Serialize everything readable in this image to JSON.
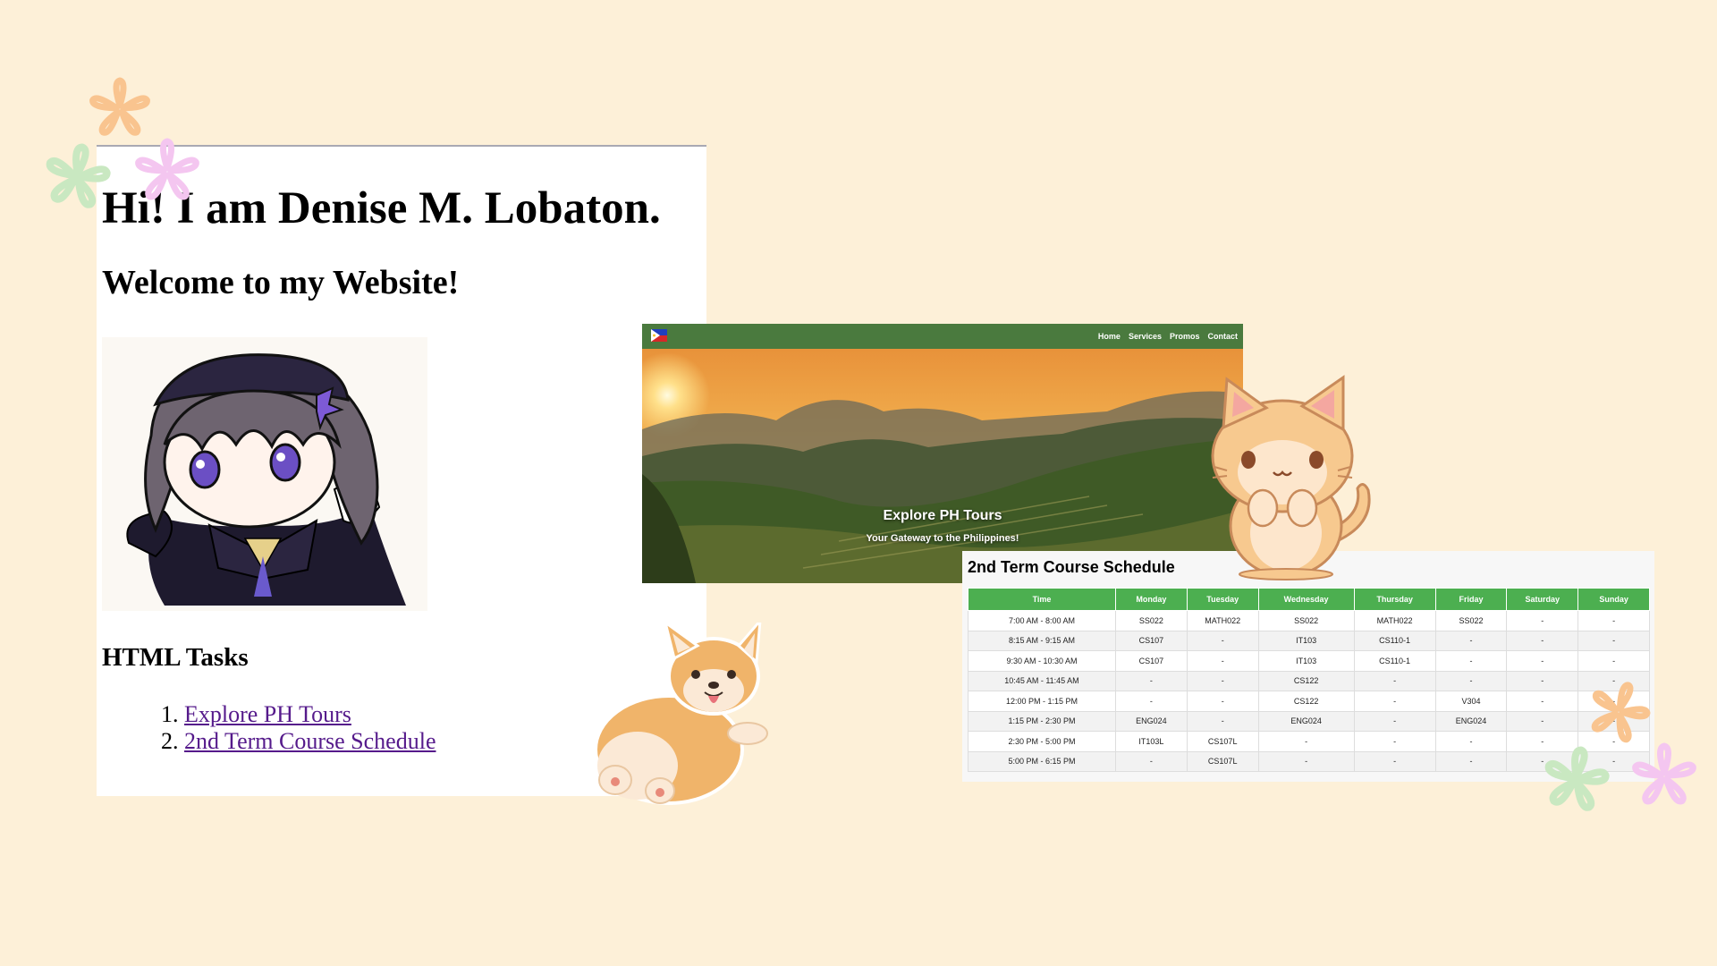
{
  "colors": {
    "background": "#fdf0d8",
    "link": "#551a8b",
    "nav_green": "#4a7a3e",
    "table_header": "#4caf50",
    "flower_orange": "#f9c48f",
    "flower_green": "#c9e8c1",
    "flower_pink": "#f4c6f0"
  },
  "home": {
    "heading": "Hi! I am Denise M. Lobaton.",
    "welcome": "Welcome to my Website!",
    "tasks_heading": "HTML Tasks",
    "tasks": [
      {
        "number": "1.",
        "label": "Explore PH Tours"
      },
      {
        "number": "2.",
        "label": "2nd Term Course Schedule"
      }
    ]
  },
  "tours": {
    "nav": [
      "Home",
      "Services",
      "Promos",
      "Contact"
    ],
    "hero_title": "Explore PH Tours",
    "hero_subtitle": "Your Gateway to the Philippines!"
  },
  "schedule": {
    "title": "2nd Term Course Schedule",
    "columns": [
      "Time",
      "Monday",
      "Tuesday",
      "Wednesday",
      "Thursday",
      "Friday",
      "Saturday",
      "Sunday"
    ],
    "rows": [
      [
        "7:00 AM - 8:00 AM",
        "SS022",
        "MATH022",
        "SS022",
        "MATH022",
        "SS022",
        "-",
        "-"
      ],
      [
        "8:15 AM - 9:15 AM",
        "CS107",
        "-",
        "IT103",
        "CS110-1",
        "-",
        "-",
        "-"
      ],
      [
        "9:30 AM - 10:30 AM",
        "CS107",
        "-",
        "IT103",
        "CS110-1",
        "-",
        "-",
        "-"
      ],
      [
        "10:45 AM - 11:45 AM",
        "-",
        "-",
        "CS122",
        "-",
        "-",
        "-",
        "-"
      ],
      [
        "12:00 PM - 1:15 PM",
        "-",
        "-",
        "CS122",
        "-",
        "V304",
        "-",
        "-"
      ],
      [
        "1:15 PM - 2:30 PM",
        "ENG024",
        "-",
        "ENG024",
        "-",
        "ENG024",
        "-",
        "-"
      ],
      [
        "2:30 PM - 5:00 PM",
        "IT103L",
        "CS107L",
        "-",
        "-",
        "-",
        "-",
        "-"
      ],
      [
        "5:00 PM - 6:15 PM",
        "-",
        "CS107L",
        "-",
        "-",
        "-",
        "-",
        "-"
      ]
    ]
  },
  "icons": [
    "flower-icon",
    "ph-flag-icon",
    "anime-avatar-illustration",
    "corgi-sticker",
    "cat-sticker"
  ]
}
